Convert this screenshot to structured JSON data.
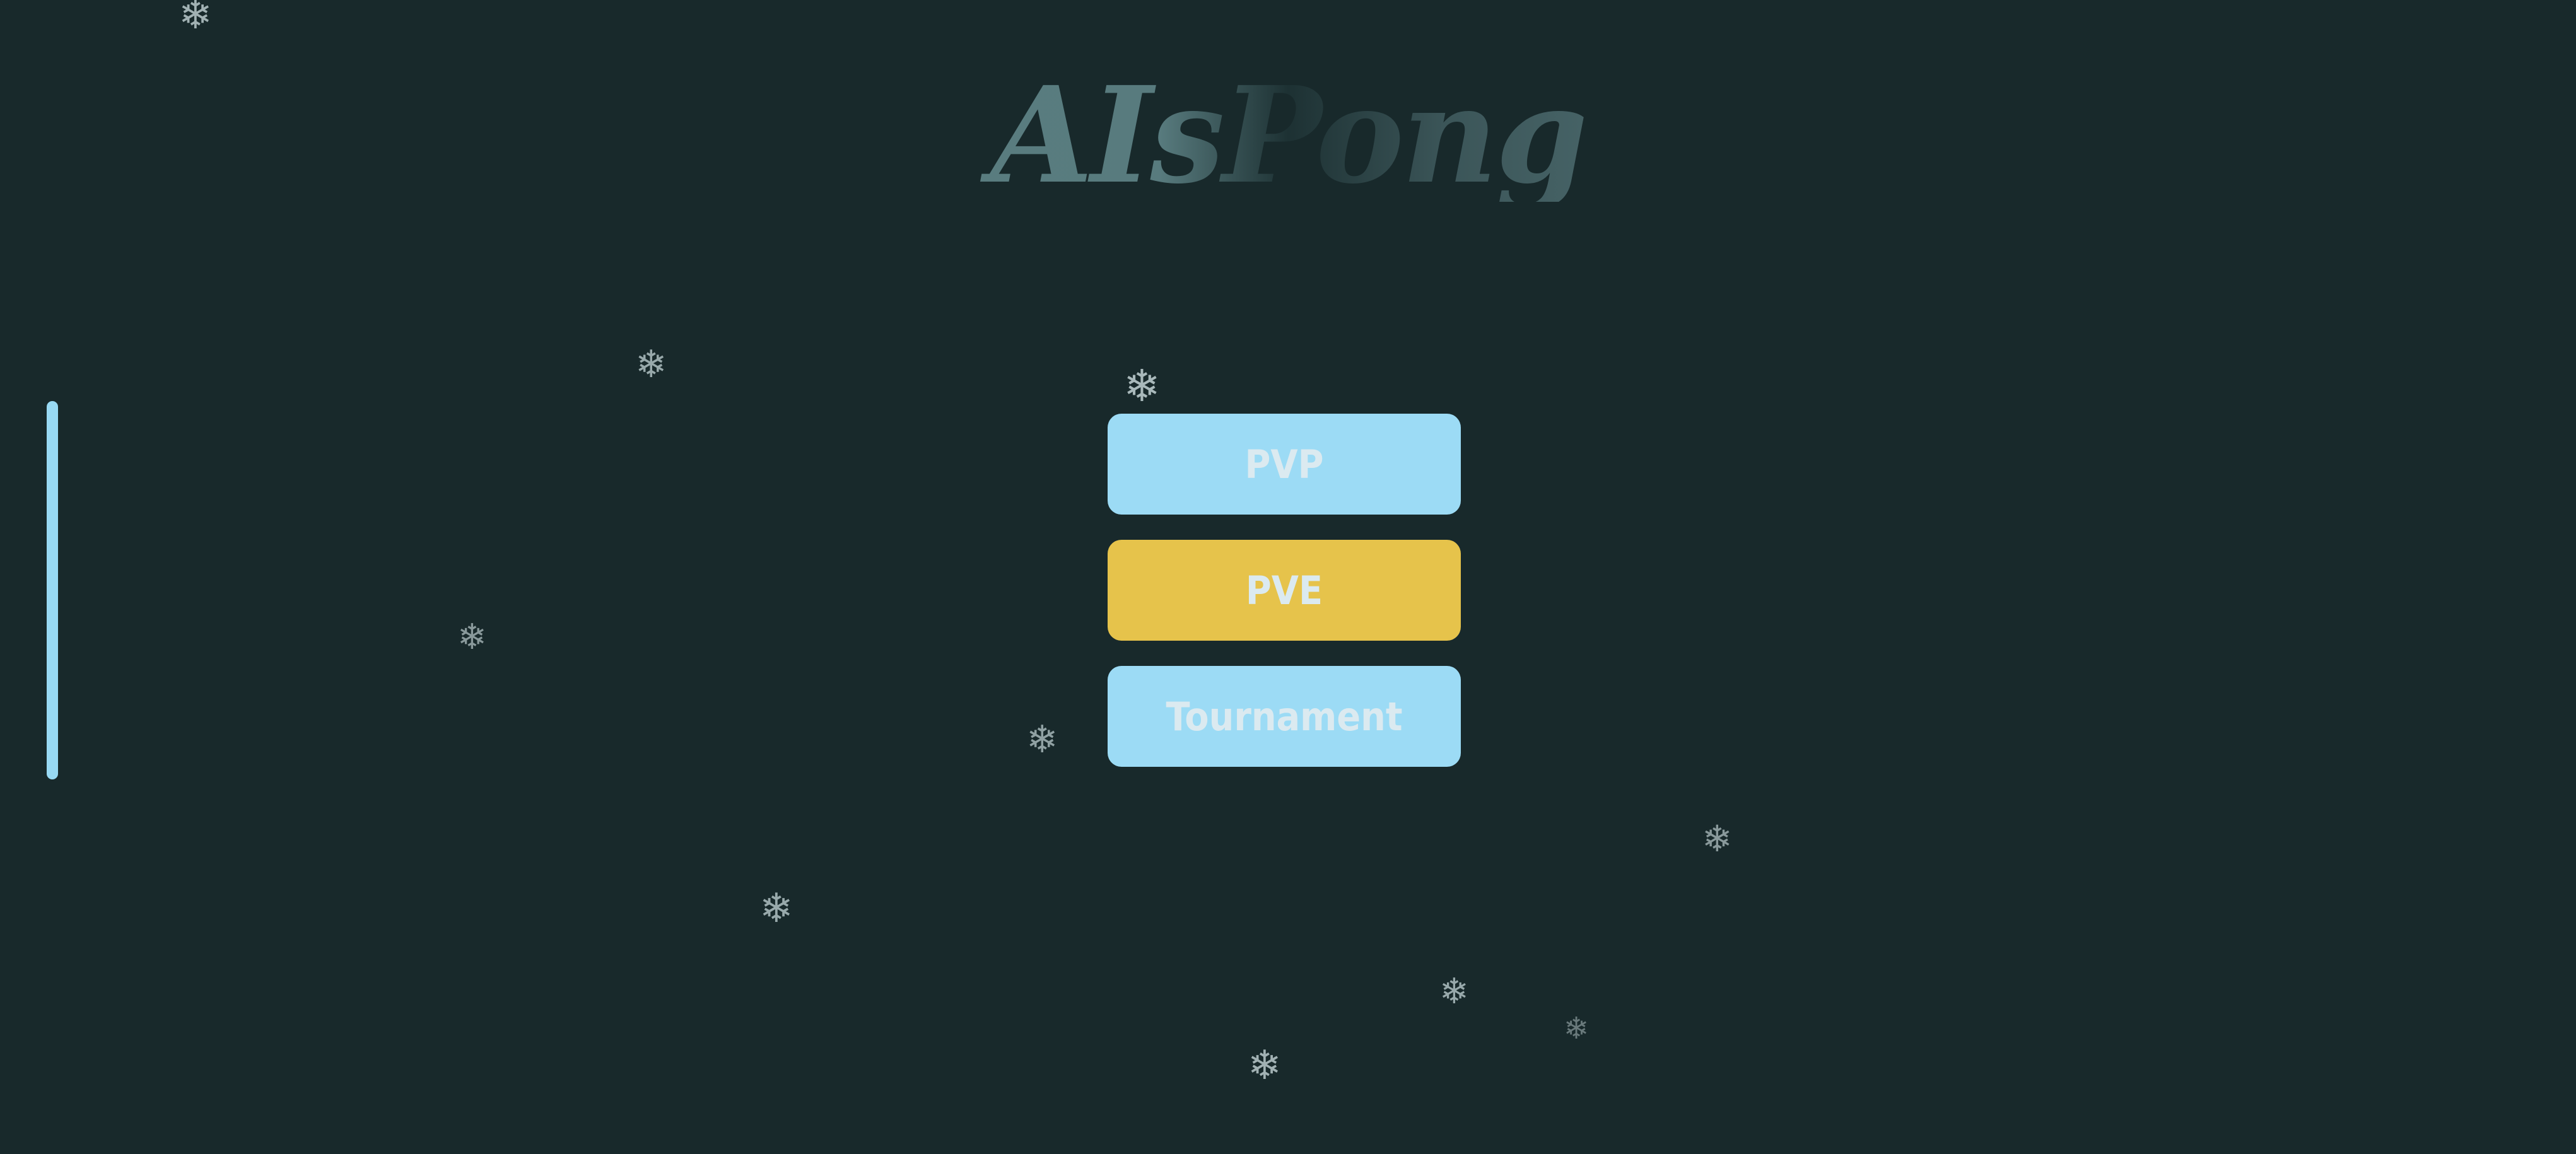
{
  "game": {
    "title": "AIsPong",
    "menu": {
      "pvp_label": "PVP",
      "pve_label": "PVE",
      "tournament_label": "Tournament"
    },
    "snowflake_glyph": "❄",
    "colors": {
      "background": "#18292b",
      "title": "#5f8286",
      "paddle": "#98d9f3",
      "button_blue": "#9cdbf5",
      "button_gold": "#e6c34b",
      "button_text": "#dbeaf0",
      "snowflake": "#b9c9cb"
    }
  }
}
